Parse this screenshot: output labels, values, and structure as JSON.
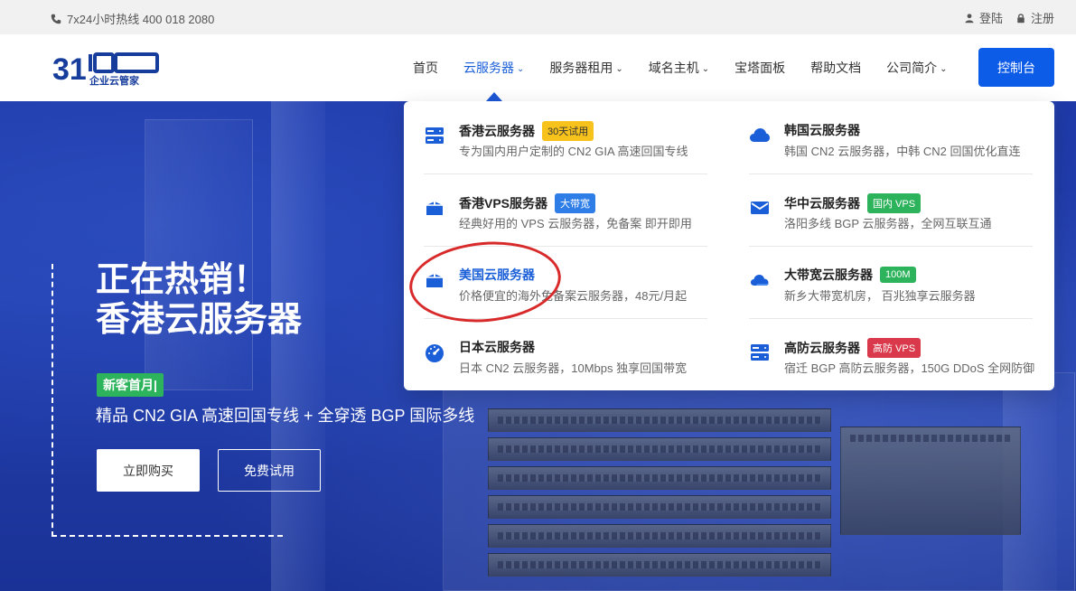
{
  "topbar": {
    "hotline": "7x24小时热线 400 018 2080",
    "login": "登陆",
    "register": "注册"
  },
  "header": {
    "nav": [
      {
        "label": "首页",
        "has_dropdown": false
      },
      {
        "label": "云服务器",
        "has_dropdown": true,
        "active": true
      },
      {
        "label": "服务器租用",
        "has_dropdown": true
      },
      {
        "label": "域名主机",
        "has_dropdown": true
      },
      {
        "label": "宝塔面板",
        "has_dropdown": false
      },
      {
        "label": "帮助文档",
        "has_dropdown": false
      },
      {
        "label": "公司简介",
        "has_dropdown": true
      }
    ],
    "console_label": "控制台",
    "colors": {
      "accent": "#0d5ce8",
      "active_nav": "#1a5fd8"
    }
  },
  "dropdown": {
    "items": [
      {
        "name": "香港云服务器",
        "tag": "30天试用",
        "tag_color": "yellow",
        "desc": "专为国内用户定制的 CN2 GIA 高速回国专线",
        "icon": "server-icon"
      },
      {
        "name": "韩国云服务器",
        "tag": "",
        "tag_color": "",
        "desc": "韩国 CN2 云服务器，中韩 CN2 回国优化直连",
        "icon": "cloud-icon"
      },
      {
        "name": "香港VPS服务器",
        "tag": "大带宽",
        "tag_color": "blue",
        "desc": "经典好用的 VPS 云服务器，免备案 即开即用",
        "icon": "box-icon"
      },
      {
        "name": "华中云服务器",
        "tag": "国内 VPS",
        "tag_color": "green",
        "desc": "洛阳多线 BGP 云服务器，全网互联互通",
        "icon": "mail-icon"
      },
      {
        "name": "美国云服务器",
        "tag": "",
        "tag_color": "",
        "desc": "价格便宜的海外免备案云服务器，48元/月起",
        "icon": "box-icon"
      },
      {
        "name": "大带宽云服务器",
        "tag": "100M",
        "tag_color": "green",
        "desc": "新乡大带宽机房， 百兆独享云服务器",
        "icon": "cloud-icon"
      },
      {
        "name": "日本云服务器",
        "tag": "",
        "tag_color": "",
        "desc": "日本 CN2 云服务器，10Mbps 独享回国带宽",
        "icon": "gauge-icon"
      },
      {
        "name": "高防云服务器",
        "tag": "高防 VPS",
        "tag_color": "red",
        "desc": "宿迁 BGP 高防云服务器，150G DDoS 全网防御",
        "icon": "server-icon"
      }
    ]
  },
  "hero": {
    "title_line1": "正在热销！",
    "title_line2": "香港云服务器",
    "badge": "新客首月|",
    "subtitle": "精品 CN2 GIA 高速回国专线 + 全穿透 BGP 国际多线",
    "buy_label": "立即购买",
    "trial_label": "免费试用"
  }
}
